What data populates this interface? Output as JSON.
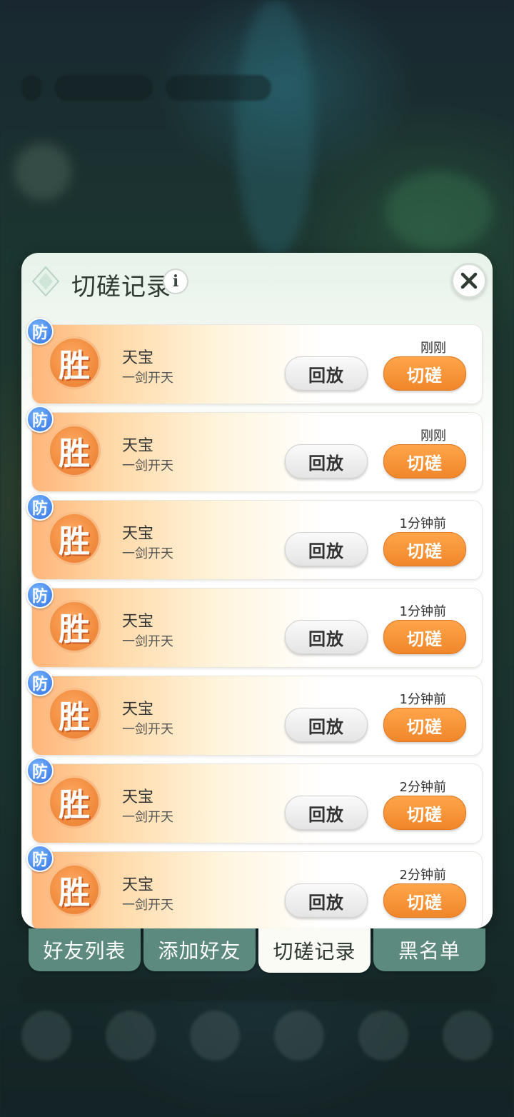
{
  "dialog": {
    "title": "切磋记录",
    "info_icon": "i",
    "close_icon": "close-icon"
  },
  "records": [
    {
      "badge": "防",
      "result": "胜",
      "name": "天宝",
      "subtitle": "一剑开天",
      "time": "刚刚",
      "replay_label": "回放",
      "spar_label": "切磋"
    },
    {
      "badge": "防",
      "result": "胜",
      "name": "天宝",
      "subtitle": "一剑开天",
      "time": "刚刚",
      "replay_label": "回放",
      "spar_label": "切磋"
    },
    {
      "badge": "防",
      "result": "胜",
      "name": "天宝",
      "subtitle": "一剑开天",
      "time": "1分钟前",
      "replay_label": "回放",
      "spar_label": "切磋"
    },
    {
      "badge": "防",
      "result": "胜",
      "name": "天宝",
      "subtitle": "一剑开天",
      "time": "1分钟前",
      "replay_label": "回放",
      "spar_label": "切磋"
    },
    {
      "badge": "防",
      "result": "胜",
      "name": "天宝",
      "subtitle": "一剑开天",
      "time": "1分钟前",
      "replay_label": "回放",
      "spar_label": "切磋"
    },
    {
      "badge": "防",
      "result": "胜",
      "name": "天宝",
      "subtitle": "一剑开天",
      "time": "2分钟前",
      "replay_label": "回放",
      "spar_label": "切磋"
    },
    {
      "badge": "防",
      "result": "胜",
      "name": "天宝",
      "subtitle": "一剑开天",
      "time": "2分钟前",
      "replay_label": "回放",
      "spar_label": "切磋"
    }
  ],
  "tabs": [
    {
      "label": "好友列表",
      "active": false
    },
    {
      "label": "添加好友",
      "active": false
    },
    {
      "label": "切磋记录",
      "active": true
    },
    {
      "label": "黑名单",
      "active": false
    }
  ],
  "colors": {
    "spar_button": "#f0862a",
    "defense_badge": "#2f6fe0",
    "tab_inactive": "#5c8a7f",
    "tab_active": "#fbfbf5"
  }
}
